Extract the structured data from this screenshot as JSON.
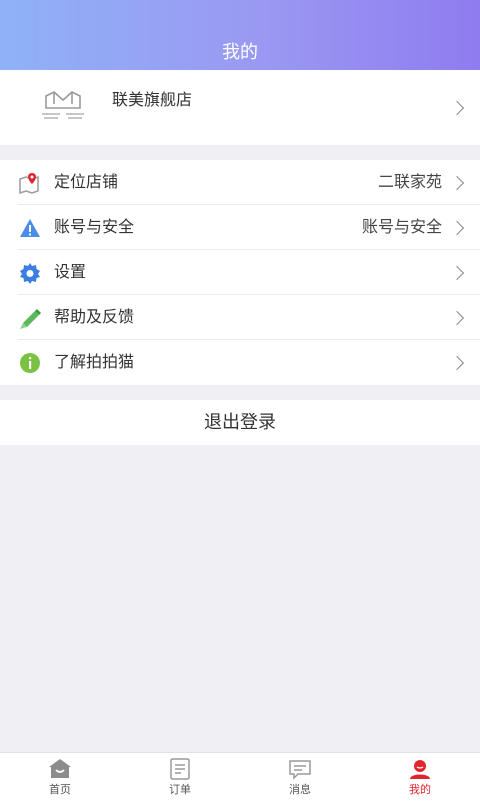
{
  "header": {
    "title": "我的"
  },
  "store": {
    "name": "联美旗舰店"
  },
  "menu": [
    {
      "label": "定位店铺",
      "value": "二联家苑",
      "icon": "map-pin-icon"
    },
    {
      "label": "账号与安全",
      "value": "账号与安全",
      "icon": "warning-icon"
    },
    {
      "label": "设置",
      "value": "",
      "icon": "gear-icon"
    },
    {
      "label": "帮助及反馈",
      "value": "",
      "icon": "pencil-icon"
    },
    {
      "label": "了解拍拍猫",
      "value": "",
      "icon": "info-icon"
    }
  ],
  "logout_label": "退出登录",
  "tabs": [
    {
      "label": "首页",
      "icon": "home-icon",
      "active": false
    },
    {
      "label": "订单",
      "icon": "order-icon",
      "active": false
    },
    {
      "label": "消息",
      "icon": "message-icon",
      "active": false
    },
    {
      "label": "我的",
      "icon": "profile-icon",
      "active": true
    }
  ],
  "colors": {
    "header_gradient": [
      "#8fb2f7",
      "#8f7cf0"
    ],
    "accent_red": "#e0252c",
    "background": "#efeff4"
  }
}
